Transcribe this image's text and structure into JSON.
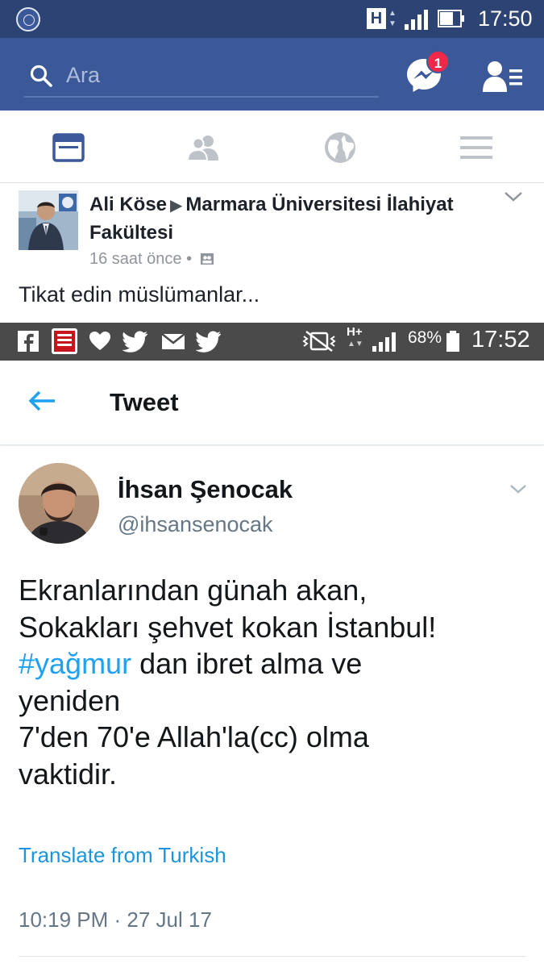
{
  "status_bar_top": {
    "network": "H",
    "time": "17:50"
  },
  "facebook": {
    "search": {
      "placeholder": "Ara"
    },
    "messenger_badge": "1",
    "tabs": [
      "news-feed",
      "friends",
      "notifications",
      "menu"
    ],
    "post": {
      "author": "Ali Köse",
      "target": "Marmara Üniversitesi İlahiyat Fakültesi",
      "time": "16 saat önce",
      "separator": "•",
      "text": "Tikat edin müslümanlar..."
    }
  },
  "status_bar_embedded": {
    "network": "H+",
    "battery": "68%",
    "time": "17:52"
  },
  "twitter": {
    "header_title": "Tweet",
    "tweet": {
      "name": "İhsan Şenocak",
      "handle": "@ihsansenocak",
      "text_lines": {
        "line1": "Ekranlarından günah akan,",
        "line2": "Sokakları şehvet kokan İstanbul!",
        "hashtag": "#yağmur",
        "line3_rest": " dan ibret alma ve",
        "line4": "yeniden",
        "line5": "7'den 70'e Allah'la(cc) olma",
        "line6": "vaktidir."
      },
      "translate": "Translate from Turkish",
      "timestamp": "10:19 PM · 27 Jul 17"
    }
  },
  "colors": {
    "facebook_blue": "#3b5998",
    "facebook_dark": "#2d4373",
    "twitter_blue": "#1da1f2",
    "badge_red": "#f02849"
  }
}
